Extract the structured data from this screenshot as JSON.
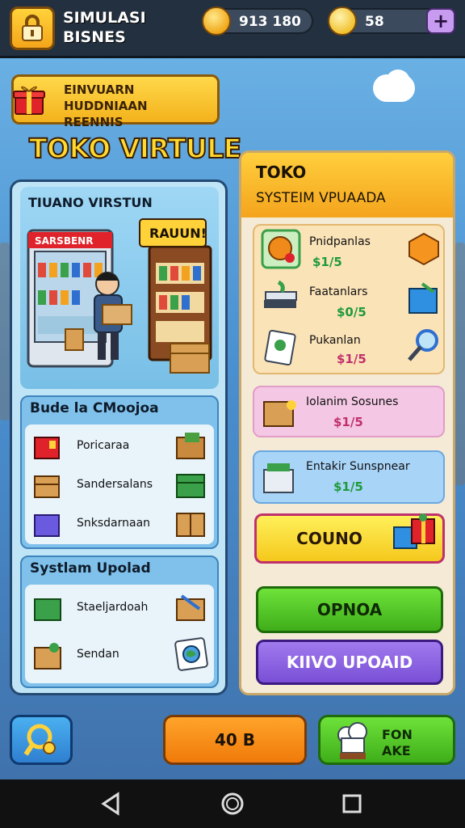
{
  "header": {
    "title": "SIMULASI BISNES",
    "coins": "913 180",
    "gems": "58",
    "plus_label": "+"
  },
  "event": {
    "text": "EINVUARN HUDDNIAAN REENNIS"
  },
  "store_heading": "TOKO VIRTULE",
  "left_panel": {
    "scene_title": "TIUANO VIRSTUN",
    "scene_sign": "SARSBENR",
    "scene_bubble": "RAUUN!",
    "card1": {
      "title": "Bude la CMoojoa",
      "items": [
        {
          "label": "Poricaraa"
        },
        {
          "label": "Sandersalans"
        },
        {
          "label": "Snksdarnaan"
        }
      ]
    },
    "card2": {
      "title": "Systlam Upolad",
      "items": [
        {
          "label": "Staeljardoah"
        },
        {
          "label": "Sendan"
        }
      ]
    }
  },
  "right_panel": {
    "title": "TOKO",
    "subtitle": "SYSTEIM VPUAADA",
    "group1": [
      {
        "name": "Pnidpanlas",
        "price": "$1/5"
      },
      {
        "name": "Faatanlars",
        "price": "$0/5"
      },
      {
        "name": "Pukanlan",
        "price": "$1/5"
      }
    ],
    "card_pink": {
      "name": "Iolanim Sosunes",
      "price": "$1/5"
    },
    "card_blue": {
      "name": "Entakir Sunspnear",
      "price": "$1/5"
    },
    "buttons": {
      "yellow": "COUNO",
      "green": "OPNOA",
      "purple": "KIIVO UPOAID"
    }
  },
  "bottom": {
    "middle_label": "40 B",
    "right_label": "FON AKE"
  },
  "colors": {
    "accent_yellow": "#ffd23a",
    "green": "#5ccf2c",
    "purple": "#8a5ce0",
    "price_pink": "#c0306c",
    "price_green": "#1e9a3a"
  }
}
